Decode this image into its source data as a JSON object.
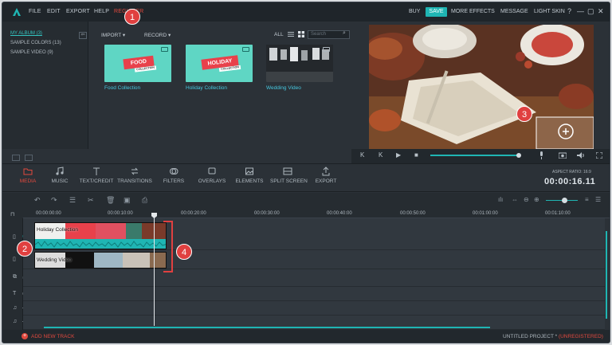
{
  "menu": {
    "items": [
      "FILE",
      "EDIT",
      "EXPORT",
      "HELP",
      "REGISTER"
    ],
    "right": [
      "BUY",
      "SAVE",
      "MORE EFFECTS",
      "MESSAGE",
      "LIGHT SKIN"
    ],
    "window": [
      "?",
      "—",
      "▢",
      "✕"
    ]
  },
  "library": {
    "items": [
      "MY ALBUM (3)",
      "SAMPLE COLORS (13)",
      "SAMPLE VIDEO (9)"
    ],
    "back": "⇦"
  },
  "media": {
    "import": "IMPORT ▾",
    "record": "RECORD ▾",
    "all": "ALL",
    "search_placeholder": "Search",
    "thumbs": [
      {
        "caption": "Food Collection",
        "banner": "FOOD",
        "tag": "COLLECTION"
      },
      {
        "caption": "Holiday Collection",
        "banner": "HOLIDAY",
        "tag": "COLLECTION"
      },
      {
        "caption": "Wedding Video"
      }
    ]
  },
  "preview_ctrl": [
    "K",
    "K",
    "▶",
    "■"
  ],
  "tools": [
    {
      "label": "MEDIA",
      "icon": "folder-icon"
    },
    {
      "label": "MUSIC",
      "icon": "music-note-icon"
    },
    {
      "label": "TEXT/CREDIT",
      "icon": "text-icon"
    },
    {
      "label": "TRANSITIONS",
      "icon": "transitions-icon"
    },
    {
      "label": "FILTERS",
      "icon": "filters-icon"
    },
    {
      "label": "OVERLAYS",
      "icon": "overlays-icon"
    },
    {
      "label": "ELEMENTS",
      "icon": "elements-icon"
    },
    {
      "label": "SPLIT SCREEN",
      "icon": "split-screen-icon"
    },
    {
      "label": "EXPORT",
      "icon": "export-icon"
    }
  ],
  "aspect": "ASPECT RATIO: 16:9",
  "timecode": "00:00:16.11",
  "ruler": [
    "00:00:00:00",
    "00:00:10:00",
    "00:00:20:00",
    "00:00:30:00",
    "00:00:40:00",
    "00:00:50:00",
    "00:01:00:00",
    "00:01:10:00"
  ],
  "clips": {
    "holiday": "Holiday Collection",
    "wedding": "Wedding Video"
  },
  "footer": {
    "add_track": "ADD NEW TRACK",
    "project": "UNTITLED PROJECT *",
    "unregistered": "(UNREGISTERED)"
  },
  "callouts": [
    "1",
    "2",
    "3",
    "4"
  ],
  "colors": {
    "accent": "#1fb5b3",
    "alert": "#e0493e",
    "panel": "#2b3137"
  }
}
